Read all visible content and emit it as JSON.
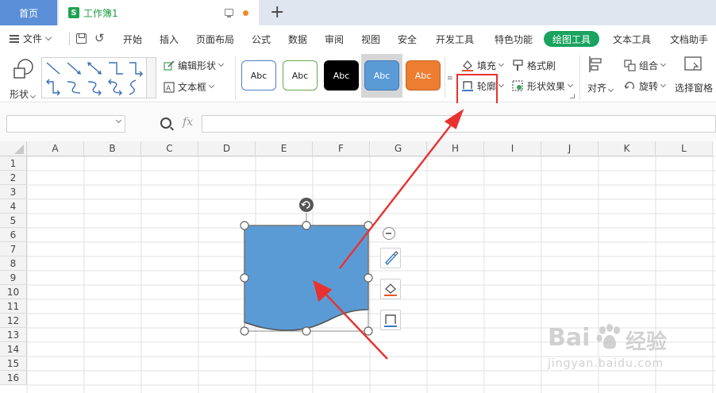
{
  "tabs": {
    "home_label": "首页",
    "doc_label": "工作簿1",
    "doc_icon_letter": "S"
  },
  "menu": {
    "file_label": "文件",
    "items": [
      "开始",
      "插入",
      "页面布局",
      "公式",
      "数据",
      "审阅",
      "视图",
      "安全",
      "开发工具",
      "特色功能",
      "绘图工具",
      "文本工具",
      "文档助手"
    ],
    "active_item": "绘图工具"
  },
  "ribbon": {
    "shape_label": "形状",
    "edit_shape_label": "编辑形状",
    "textbox_label": "文本框",
    "style_samples": [
      "Abc",
      "Abc",
      "Abc",
      "Abc",
      "Abc"
    ],
    "fill_label": "填充",
    "format_brush_label": "格式刷",
    "outline_label": "轮廓",
    "shape_effect_label": "形状效果",
    "align_label": "对齐",
    "group_label": "组合",
    "rotate_label": "旋转",
    "select_pane_label": "选择窗格"
  },
  "formula": {
    "name_box": "",
    "fx_label": "fx",
    "formula_value": ""
  },
  "sheet": {
    "columns": [
      "A",
      "B",
      "C",
      "D",
      "E",
      "F",
      "G",
      "H",
      "I",
      "J",
      "K",
      "L"
    ],
    "rows": [
      "1",
      "2",
      "3",
      "4",
      "5",
      "6",
      "7",
      "8",
      "9",
      "10",
      "11",
      "12",
      "13",
      "14",
      "15",
      "16"
    ]
  },
  "shape": {
    "fill_color": "#5b9bd5",
    "outline_color": "#555555"
  },
  "colors": {
    "accent_green": "#1aa35f",
    "home_tab_blue": "#5a8fd8",
    "annotation_red": "#e8322f"
  },
  "watermark": {
    "brand_text": "Bai",
    "brand_suffix": "经验",
    "url": "jingyan.baidu.com"
  }
}
